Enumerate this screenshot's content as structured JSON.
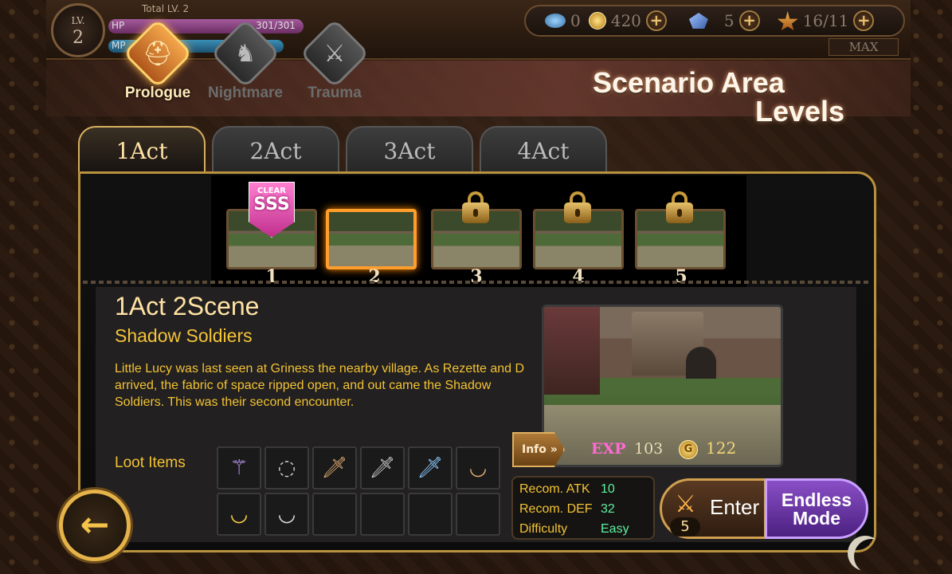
{
  "hud": {
    "level_label": "LV.",
    "level_value": "2",
    "total_lv_label": "Total LV.",
    "total_lv_value": "2",
    "hp_label": "HP",
    "hp_value": "301/301",
    "mp_label": "MP",
    "gems": "0",
    "gold": "420",
    "crystals": "5",
    "stamina": "16/11",
    "max_label": "MAX"
  },
  "difficulties": [
    {
      "label": "Prologue",
      "active": true,
      "icon": "helmet-icon"
    },
    {
      "label": "Nightmare",
      "active": false,
      "icon": "knight-helmet-icon"
    },
    {
      "label": "Trauma",
      "active": false,
      "icon": "weapon-icon"
    }
  ],
  "title": {
    "line1": "Scenario Area",
    "line2": "Levels"
  },
  "acts": [
    "1Act",
    "2Act",
    "3Act",
    "4Act"
  ],
  "scenes": [
    {
      "num": "1",
      "state": "cleared",
      "badge_top": "CLEAR",
      "badge_rank": "SSS"
    },
    {
      "num": "2",
      "state": "selected"
    },
    {
      "num": "3",
      "state": "locked"
    },
    {
      "num": "4",
      "state": "locked"
    },
    {
      "num": "5",
      "state": "locked"
    }
  ],
  "detail": {
    "heading": "1Act 2Scene",
    "subtitle": "Shadow Soldiers",
    "description": "Little Lucy was last seen at Griness the nearby village. As Rezette and D arrived, the fabric of space ripped open, and out came the Shadow Soldiers. This was their second encounter.",
    "info_label": "Info",
    "exp_label": "EXP",
    "exp_value": "103",
    "gold_icon_letter": "G",
    "gold_value": "122"
  },
  "loot": {
    "label": "Loot Items",
    "items": [
      {
        "icon": "staff-icon",
        "glyph": "⚚"
      },
      {
        "icon": "necklace-icon",
        "glyph": "◌"
      },
      {
        "icon": "dagger-icon",
        "glyph": "🗡"
      },
      {
        "icon": "dagger-icon",
        "glyph": "🗡"
      },
      {
        "icon": "dagger-blue-icon",
        "glyph": "🗡"
      },
      {
        "icon": "bracelet-icon",
        "glyph": "◡"
      },
      {
        "icon": "gold-bracelet-icon",
        "glyph": "◡"
      },
      {
        "icon": "silver-bracelet-icon",
        "glyph": "◡"
      },
      {
        "icon": "",
        "glyph": ""
      },
      {
        "icon": "",
        "glyph": ""
      },
      {
        "icon": "",
        "glyph": ""
      },
      {
        "icon": "",
        "glyph": ""
      }
    ]
  },
  "stats": {
    "atk_label": "Recom. ATK",
    "atk_value": "10",
    "def_label": "Recom. DEF",
    "def_value": "32",
    "diff_label": "Difficulty",
    "diff_value": "Easy"
  },
  "actions": {
    "enter_label": "Enter",
    "enter_cost": "5",
    "endless_line1": "Endless",
    "endless_line2": "Mode"
  },
  "colors": {
    "accent_gold": "#f2c234",
    "highlight_orange": "#ff9e2c",
    "stat_green": "#5ff0a0",
    "endless_purple": "#8a4fc7",
    "exp_pink": "#ff6ad5"
  }
}
